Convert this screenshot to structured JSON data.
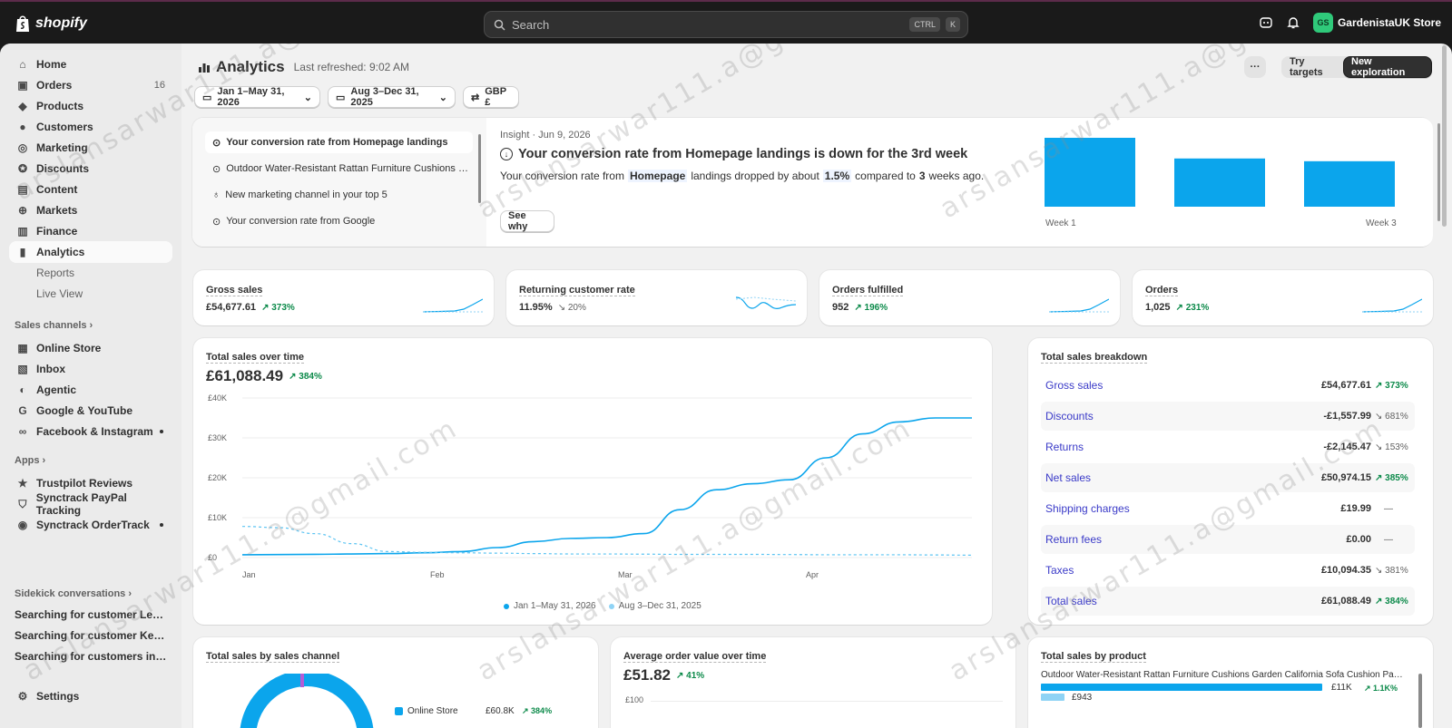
{
  "topbar": {
    "logo_text": "shopify",
    "search_placeholder": "Search",
    "kbd_ctrl": "CTRL",
    "kbd_k": "K",
    "store_initials": "GS",
    "store_name": "GardenistaUK Store"
  },
  "sidebar": {
    "main_items": [
      {
        "label": "Home",
        "icon": "home-icon"
      },
      {
        "label": "Orders",
        "icon": "orders-icon",
        "badge": "16"
      },
      {
        "label": "Products",
        "icon": "tag-icon"
      },
      {
        "label": "Customers",
        "icon": "person-icon"
      },
      {
        "label": "Marketing",
        "icon": "target-icon"
      },
      {
        "label": "Discounts",
        "icon": "discount-icon"
      },
      {
        "label": "Content",
        "icon": "content-icon"
      },
      {
        "label": "Markets",
        "icon": "globe-icon"
      },
      {
        "label": "Finance",
        "icon": "bank-icon"
      },
      {
        "label": "Analytics",
        "icon": "chart-icon"
      }
    ],
    "analytics_sub": [
      "Reports",
      "Live View"
    ],
    "sales_channels_label": "Sales channels",
    "channels": [
      {
        "label": "Online Store",
        "icon": "store-icon"
      },
      {
        "label": "Inbox",
        "icon": "inbox-icon"
      },
      {
        "label": "Agentic",
        "icon": "agentic-icon"
      },
      {
        "label": "Google & YouTube",
        "icon": "google-icon"
      },
      {
        "label": "Facebook & Instagram",
        "icon": "meta-icon"
      }
    ],
    "apps_label": "Apps",
    "apps": [
      {
        "label": "Trustpilot Reviews",
        "icon": "star-icon"
      },
      {
        "label": "Synctrack PayPal Tracking",
        "icon": "shield-icon"
      },
      {
        "label": "Synctrack OrderTrack",
        "icon": "track-icon"
      }
    ],
    "sidekick_label": "Sidekick conversations",
    "sidekick": [
      "Searching for customer Lena B...",
      "Searching for customer Kerry ...",
      "Searching for customers in Sh..."
    ],
    "settings_label": "Settings"
  },
  "header": {
    "title": "Analytics",
    "refreshed": "Last refreshed: 9:02 AM",
    "date_range": "Jan 1–May 31, 2026",
    "compare_range": "Aug 3–Dec 31, 2025",
    "currency": "GBP £",
    "more_label": "···",
    "try_targets": "Try targets",
    "new_exploration": "New exploration"
  },
  "insights": {
    "list": [
      "Your conversion rate from Homepage landings",
      "Outdoor Water-Resistant Rattan Furniture Cushions G...",
      "New marketing channel in your top 5",
      "Your conversion rate from Google"
    ],
    "date": "Insight · Jun 9, 2026",
    "headline": "Your conversion rate from Homepage landings is down for the 3rd week",
    "body_pre": "Your conversion rate from",
    "body_hl1": "Homepage",
    "body_mid": "landings dropped by about",
    "body_hl2": "1.5%",
    "body_mid2": "compared to",
    "body_hl3": "3",
    "body_post": "weeks ago.",
    "see_why": "See why",
    "week_start": "Week 1",
    "week_end": "Week 3",
    "bars": [
      1.0,
      0.7,
      0.66
    ],
    "bar_color": "#0ba5ec"
  },
  "metrics": [
    {
      "label": "Gross sales",
      "value": "£54,677.61",
      "change": "373%",
      "dir": "up"
    },
    {
      "label": "Returning customer rate",
      "value": "11.95%",
      "change": "20%",
      "dir": "down"
    },
    {
      "label": "Orders fulfilled",
      "value": "952",
      "change": "196%",
      "dir": "up"
    },
    {
      "label": "Orders",
      "value": "1,025",
      "change": "231%",
      "dir": "up"
    }
  ],
  "sales_chart": {
    "title": "Total sales over time",
    "total": "£61,088.49",
    "change": "384%",
    "legend_current": "Jan 1–May 31, 2026",
    "legend_previous": "Aug 3–Dec 31, 2025"
  },
  "chart_data": {
    "type": "line",
    "title": "Total sales over time",
    "x_ticks": [
      "Jan",
      "Feb",
      "Mar",
      "Apr"
    ],
    "y_ticks": [
      "£40K",
      "£30K",
      "£20K",
      "£10K",
      "£0"
    ],
    "ylim": [
      0,
      40000
    ],
    "xlim": [
      0,
      20
    ],
    "x": [
      0,
      1,
      2,
      3,
      4,
      5,
      6,
      7,
      8,
      9,
      10,
      11,
      12,
      13,
      14,
      15,
      16,
      17,
      18,
      19,
      20
    ],
    "series": [
      {
        "name": "Jan 1–May 31, 2026",
        "color": "#0ba5ec",
        "style": "solid",
        "values": [
          700,
          750,
          800,
          900,
          1000,
          1200,
          1500,
          2500,
          4000,
          4800,
          5000,
          6000,
          12000,
          17000,
          18500,
          19500,
          25000,
          31000,
          34000,
          35000,
          35000
        ]
      },
      {
        "name": "Aug 3–Dec 31, 2025",
        "color": "#5cc4f2",
        "style": "dashed",
        "values": [
          7800,
          7500,
          6000,
          3500,
          1500,
          1300,
          1200,
          1100,
          1000,
          900,
          900,
          850,
          800,
          800,
          800,
          750,
          700,
          700,
          700,
          650,
          600
        ]
      }
    ]
  },
  "breakdown": {
    "title": "Total sales breakdown",
    "rows": [
      {
        "label": "Gross sales",
        "value": "£54,677.61",
        "change": "373%",
        "dir": "up"
      },
      {
        "label": "Discounts",
        "value": "-£1,557.99",
        "change": "681%",
        "dir": "down"
      },
      {
        "label": "Returns",
        "value": "-£2,145.47",
        "change": "153%",
        "dir": "down"
      },
      {
        "label": "Net sales",
        "value": "£50,974.15",
        "change": "385%",
        "dir": "up"
      },
      {
        "label": "Shipping charges",
        "value": "£19.99",
        "change": "—",
        "dir": "none"
      },
      {
        "label": "Return fees",
        "value": "£0.00",
        "change": "—",
        "dir": "none"
      },
      {
        "label": "Taxes",
        "value": "£10,094.35",
        "change": "381%",
        "dir": "down"
      },
      {
        "label": "Total sales",
        "value": "£61,088.49",
        "change": "384%",
        "dir": "up"
      }
    ]
  },
  "bottom": {
    "channel_title": "Total sales by sales channel",
    "channel_legend": "Online Store",
    "channel_value": "£60.8K",
    "channel_change": "384%",
    "aov_title": "Average order value over time",
    "aov_value": "£51.82",
    "aov_change": "41%",
    "aov_tick": "£100",
    "product_title": "Total sales by product",
    "product_name": "Outdoor Water-Resistant Rattan Furniture Cushions Garden California Sofa Cushion Pads Set · ...",
    "product_value": "£11K",
    "product_prev": "£943",
    "product_change": "1.1K%"
  },
  "watermark": "arslansarwar111.a@gmail.com"
}
